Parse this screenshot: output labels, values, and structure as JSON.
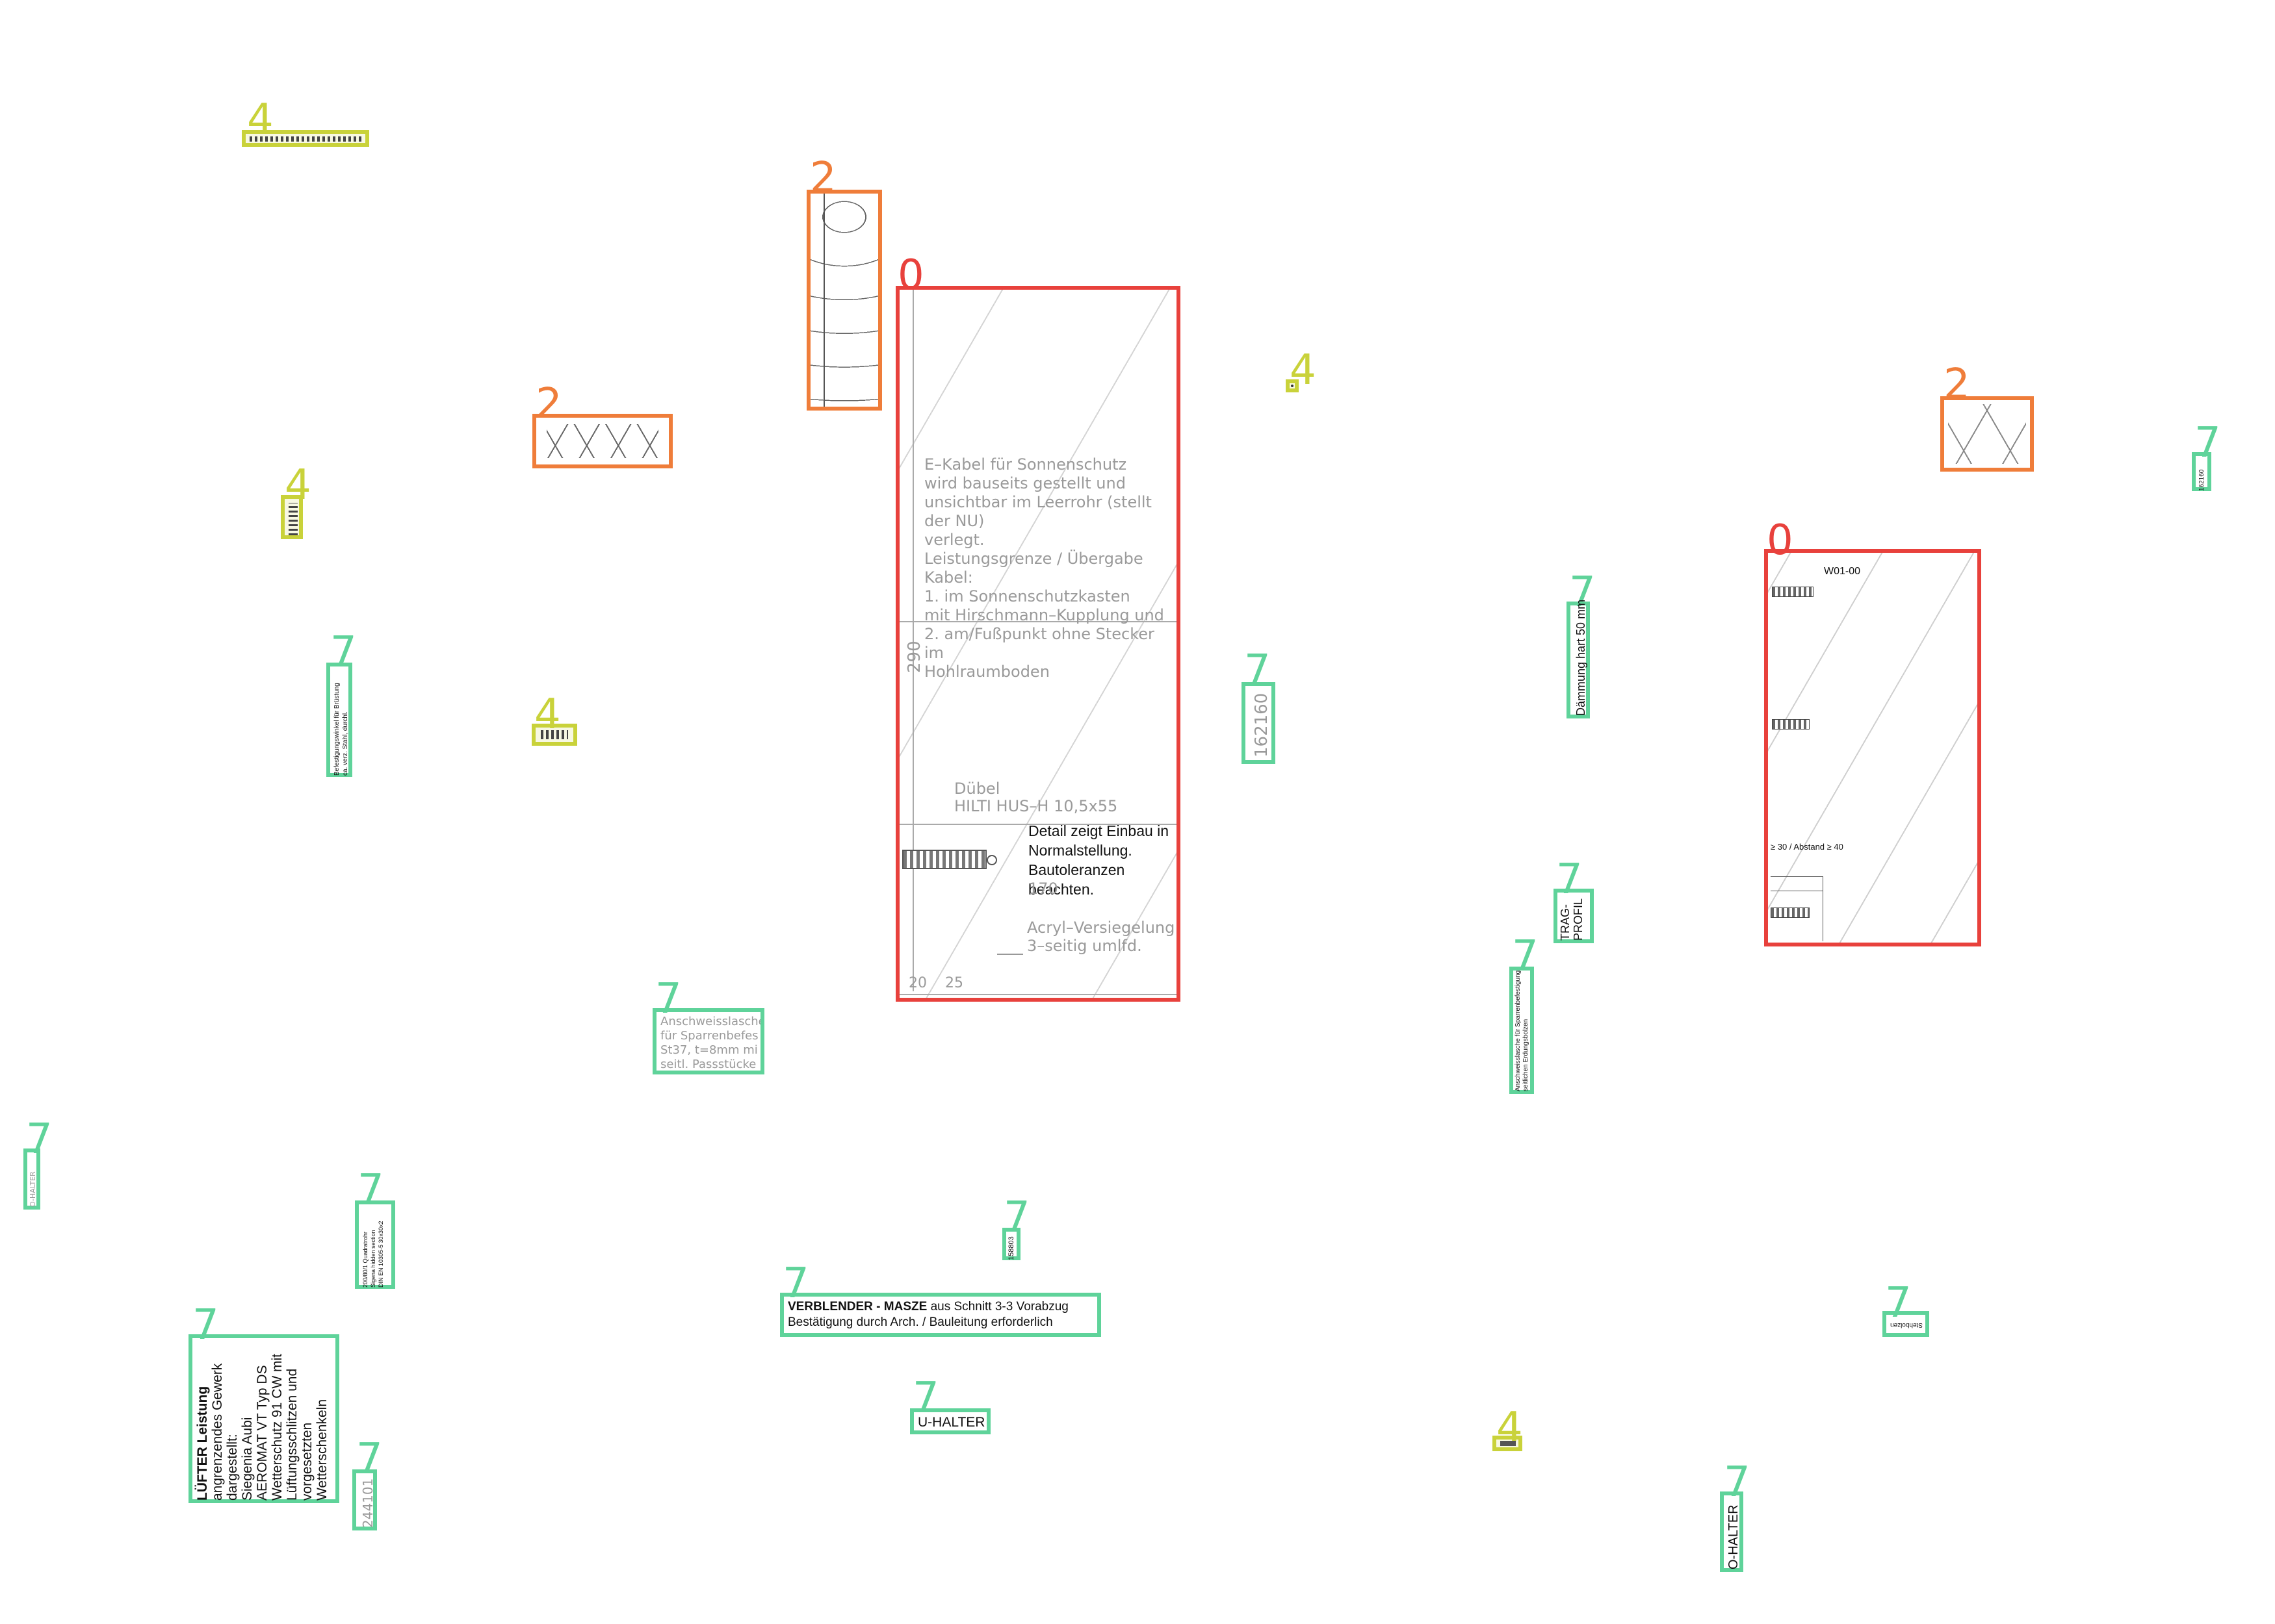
{
  "labels": {
    "cls0": "0",
    "cls2": "2",
    "cls4": "4",
    "cls7": "7"
  },
  "colors": {
    "class0": "#e8413c",
    "class2": "#ef7d3a",
    "class4": "#c9d23a",
    "class7": "#5fd39a"
  },
  "main_detail": {
    "lines": [
      "E–Kabel für Sonnenschutz",
      "wird bauseits gestellt und",
      "unsichtbar im Leerrohr (stellt der NU)",
      "verlegt.",
      "Leistungsgrenze / Übergabe Kabel:",
      "1. im Sonnenschutzkasten",
      "mit Hirschmann–Kupplung und",
      "2. am/Fußpunkt ohne Stecker im",
      "Hohlraumboden"
    ],
    "dim_290": "290",
    "dubel_1": "Dübel",
    "dubel_2": "HILTI HUS–H 10,5x55",
    "note_1": "Detail zeigt Einbau in",
    "note_2": "Normalstellung.",
    "note_3": "Bautoleranzen beachten.",
    "dim_170": "170",
    "acryl_1": "Acryl–Versiegelung",
    "acryl_2": "3–seitig umlfd.",
    "dim_20": "20",
    "dim_25": "25"
  },
  "right_detail": {
    "code": "W01-00",
    "note": "≥ 30 / Abstand ≥ 40"
  },
  "texts": {
    "t_162160": "162160",
    "t_daemmung": "Dämmung hart 50 mm",
    "t_trag_1": "TRAG-",
    "t_trag_2": "PROFIL",
    "t_anschweiss_1": "Anschweisslasche",
    "t_anschweiss_2": "für Sparrenbefes",
    "t_anschweiss_3": "St37, t=8mm mi",
    "t_anschweiss_4": "seitl. Passstücke",
    "t_verblender_1a": "VERBLENDER - MASZE",
    "t_verblender_1b": " aus Schnitt 3-3 Vorabzug",
    "t_verblender_2": "Bestätigung durch Arch. / Bauleitung erforderlich",
    "t_uhalter": "U-HALTER",
    "t_ohalter": "O-HALTER",
    "t_ohalter_small": "O-HALTER",
    "t_luefter_1": "LÜFTER Leistung",
    "t_luefter_2": "angrenzendes Gewerk",
    "t_luefter_3": "dargestellt:",
    "t_luefter_4": "Siegenia Aubi",
    "t_luefter_5": "AEROMAT VT Typ DS",
    "t_luefter_6": "Wetterschutz 91 CW mit",
    "t_luefter_7": "Lüftungsschlitzen und",
    "t_luefter_8": "vorgesetzten",
    "t_luefter_9": "Wetterschenkeln",
    "t_244101": "244101",
    "t_quadrat_1": "200/80/1 Quadratrohr",
    "t_quadrat_2": "Sigena hidden section",
    "t_quadrat_3": "DIN EN 10305-5 30x30x2",
    "t_befestigung_1": "Befestigungswinkel für Brüstung",
    "t_befestigung_2": "ca. verz. Stahl, durchl.",
    "t_158803": "158803",
    "t_small_right_top": "162160",
    "t_small_mid_right": "Stehbolzen",
    "t_vert_mid_1": "Anschweisslasche für Sparrenbefestigung",
    "t_vert_mid_2": "seitlichen Erdungsbolzen"
  }
}
